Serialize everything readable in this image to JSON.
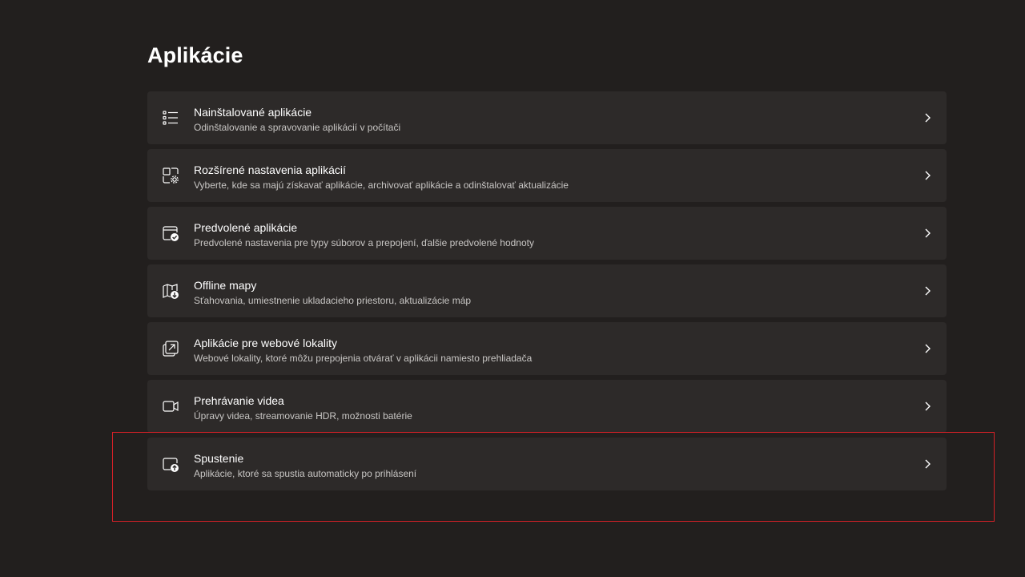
{
  "page": {
    "title": "Aplikácie"
  },
  "items": [
    {
      "title": "Nainštalované aplikácie",
      "description": "Odinštalovanie a spravovanie aplikácií v počítači",
      "icon": "installed-apps-list-icon"
    },
    {
      "title": "Rozšírené nastavenia aplikácií",
      "description": "Vyberte, kde sa majú získavať aplikácie, archivovať aplikácie a odinštalovať aktualizácie",
      "icon": "advanced-app-settings-icon"
    },
    {
      "title": "Predvolené aplikácie",
      "description": "Predvolené nastavenia pre typy súborov a prepojení, ďalšie predvolené hodnoty",
      "icon": "default-apps-icon"
    },
    {
      "title": "Offline mapy",
      "description": "Sťahovania, umiestnenie ukladacieho priestoru, aktualizácie máp",
      "icon": "offline-map-icon"
    },
    {
      "title": "Aplikácie pre webové lokality",
      "description": "Webové lokality, ktoré môžu prepojenia otvárať v aplikácii namiesto prehliadača",
      "icon": "apps-for-websites-icon"
    },
    {
      "title": "Prehrávanie videa",
      "description": "Úpravy videa, streamovanie HDR, možnosti batérie",
      "icon": "video-camera-icon"
    },
    {
      "title": "Spustenie",
      "description": "Aplikácie, ktoré sa spustia automaticky po prihlásení",
      "icon": "startup-icon"
    }
  ],
  "annotation": {
    "highlight_color": "#d42027",
    "highlighted_item": "Spustenie"
  },
  "colors": {
    "background": "#221f1e",
    "card": "#2d2a29",
    "text_primary": "#ffffff",
    "text_secondary": "#c8c6c4"
  }
}
